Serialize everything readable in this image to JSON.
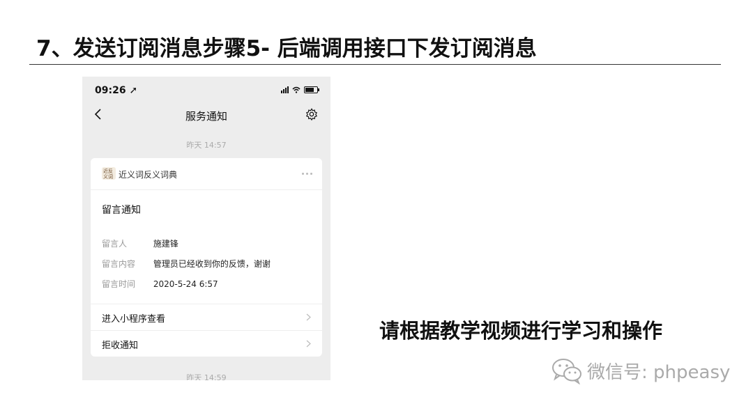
{
  "slide": {
    "title": "7、发送订阅消息步骤5- 后端调用接口下发订阅消息",
    "side_text": "请根据教学视频进行学习和操作",
    "watermark": "微信号: phpeasy"
  },
  "phone": {
    "status_time": "09:26 ➚",
    "nav_title": "服务通知",
    "timestamp_top": "昨天 14:57",
    "timestamp_bottom": "昨天 14:59",
    "card": {
      "app_name": "近义词反义词典",
      "title": "留言通知",
      "fields": [
        {
          "label": "留言人",
          "value": "施建锋"
        },
        {
          "label": "留言内容",
          "value": "管理员已经收到你的反馈，谢谢"
        },
        {
          "label": "留言时间",
          "value": "2020-5-24 6:57"
        }
      ],
      "actions": [
        {
          "label": "进入小程序查看"
        },
        {
          "label": "拒收通知"
        }
      ]
    }
  },
  "colors": {
    "phone_bg": "#ededed",
    "card_bg": "#ffffff",
    "muted_text": "#999999",
    "watermark": "#aaaaaa"
  }
}
